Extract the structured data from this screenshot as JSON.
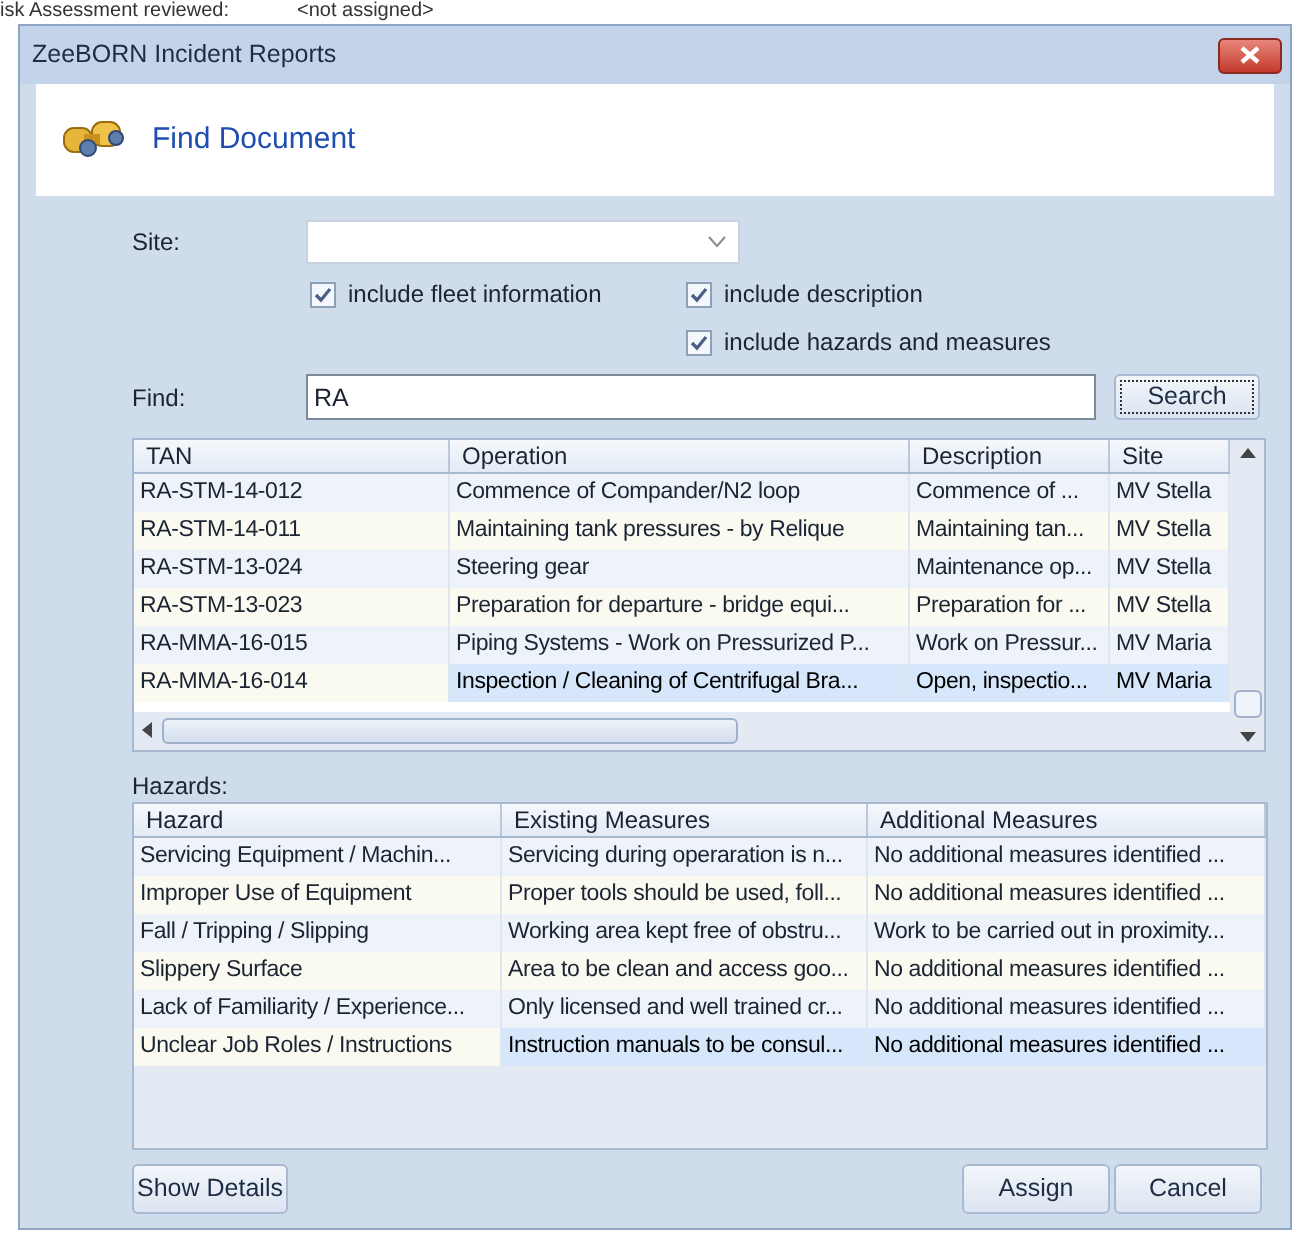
{
  "background_window": {
    "label": "isk Assessment reviewed:",
    "value": "<not assigned>"
  },
  "window": {
    "title": "ZeeBORN Incident Reports"
  },
  "header": {
    "title": "Find Document"
  },
  "site": {
    "label": "Site:"
  },
  "options": [
    {
      "label": "include fleet information",
      "checked": true
    },
    {
      "label": "include description",
      "checked": true
    },
    {
      "label": "include hazards and measures",
      "checked": true
    }
  ],
  "find": {
    "label": "Find:",
    "value": "RA",
    "button": "Search"
  },
  "documents": {
    "columns": [
      "TAN",
      "Operation",
      "Description",
      "Site"
    ],
    "rows": [
      {
        "cells": [
          "RA-STM-14-012",
          "Commence of Compander/N2 loop",
          "Commence of ...",
          "MV Stella"
        ],
        "selected": false
      },
      {
        "cells": [
          "RA-STM-14-011",
          "Maintaining tank pressures - by Relique",
          "Maintaining tan...",
          "MV Stella"
        ],
        "selected": false
      },
      {
        "cells": [
          "RA-STM-13-024",
          "Steering gear",
          "Maintenance op...",
          "MV Stella"
        ],
        "selected": false
      },
      {
        "cells": [
          "RA-STM-13-023",
          "Preparation for departure - bridge equi...",
          "Preparation for ...",
          "MV Stella"
        ],
        "selected": false
      },
      {
        "cells": [
          "RA-MMA-16-015",
          "Piping Systems - Work on Pressurized P...",
          "Work on Pressur...",
          "MV Maria"
        ],
        "selected": false
      },
      {
        "cells": [
          "RA-MMA-16-014",
          "Inspection / Cleaning of Centrifugal Bra...",
          "Open, inspectio...",
          "MV Maria"
        ],
        "selected": true
      }
    ]
  },
  "hazards": {
    "label": "Hazards:",
    "columns": [
      "Hazard",
      "Existing Measures",
      "Additional Measures"
    ],
    "rows": [
      {
        "cells": [
          "Servicing Equipment / Machin...",
          "Servicing during operaration is n...",
          "No additional measures identified ..."
        ],
        "selected": false
      },
      {
        "cells": [
          "Improper Use of Equipment",
          "Proper tools should be used, foll...",
          "No additional measures identified ..."
        ],
        "selected": false
      },
      {
        "cells": [
          "Fall / Tripping / Slipping",
          "Working area kept free of obstru...",
          "Work to be carried out in proximity..."
        ],
        "selected": false
      },
      {
        "cells": [
          "Slippery Surface",
          "Area to be clean and access goo...",
          "No additional measures identified ..."
        ],
        "selected": false
      },
      {
        "cells": [
          "Lack of Familiarity / Experience...",
          "Only licensed and well trained cr...",
          "No additional measures identified ..."
        ],
        "selected": false
      },
      {
        "cells": [
          "Unclear Job Roles / Instructions",
          "Instruction manuals to be consul...",
          "No additional measures identified ..."
        ],
        "selected": true
      }
    ]
  },
  "buttons": {
    "details": "Show Details",
    "assign": "Assign",
    "cancel": "Cancel"
  }
}
